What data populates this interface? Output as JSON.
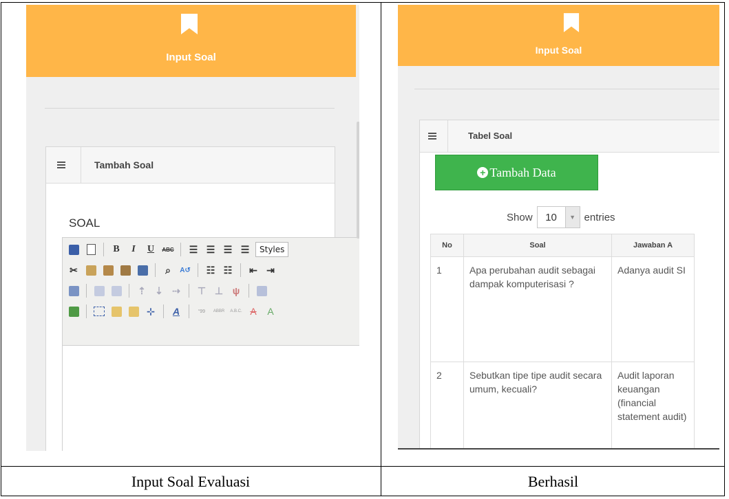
{
  "left_screen": {
    "header_title": "Input Soal",
    "panel_title": "Tambah Soal",
    "field_label": "SOAL",
    "editor": {
      "styles_label": "Styles",
      "row1": [
        "save-icon",
        "new-document-icon",
        "bold-icon",
        "italic-icon",
        "underline-icon",
        "strikethrough-icon",
        "align-left-icon",
        "align-center-icon",
        "align-right-icon",
        "align-justify-icon"
      ],
      "row2": [
        "cut-icon",
        "copy-icon",
        "paste-icon",
        "paste-text-icon",
        "paste-word-icon",
        "find-icon",
        "replace-icon",
        "bullet-list-icon",
        "numbered-list-icon",
        "outdent-icon",
        "indent-icon"
      ],
      "row3": [
        "edit-icon",
        "table-row-icon",
        "table-col-icon",
        "insert-row-before-icon",
        "insert-row-after-icon",
        "delete-row-icon",
        "merge-cells-icon",
        "split-cells-icon",
        "table-icon"
      ],
      "row4": [
        "image-icon",
        "layer-icon",
        "move-forward-icon",
        "move-backward-icon",
        "absolute-icon",
        "font-color-icon",
        "cite-icon",
        "abbr-icon",
        "acronym-icon",
        "del-icon",
        "ins-icon"
      ]
    }
  },
  "right_screen": {
    "header_title": "Input Soal",
    "panel_title": "Tabel Soal",
    "add_button": "Tambah Data",
    "show_label": "Show",
    "entries_value": "10",
    "entries_label": "entries",
    "table": {
      "columns": [
        "No",
        "Soal",
        "Jawaban A"
      ],
      "rows": [
        [
          "1",
          "Apa perubahan audit sebagai dampak komputerisasi ?",
          "Adanya audit SI"
        ],
        [
          "2",
          "Sebutkan tipe tipe audit secara umum, kecuali?",
          "Audit laporan keuangan (financial statement audit)"
        ]
      ]
    }
  },
  "captions": {
    "left": "Input Soal Evaluasi",
    "right": "Berhasil"
  },
  "colors": {
    "banner": "#ffb648",
    "add_button": "#3fb44d"
  }
}
